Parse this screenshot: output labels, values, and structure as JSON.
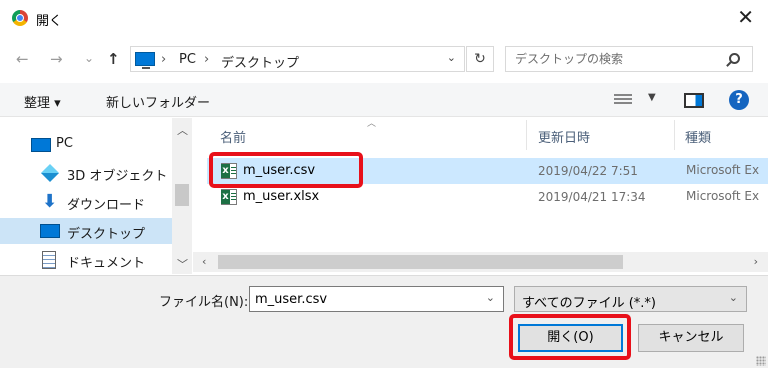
{
  "window": {
    "title": "開く",
    "close_glyph": "✕"
  },
  "nav": {
    "back_glyph": "←",
    "forward_glyph": "→",
    "recent_glyph": "⌄",
    "up_glyph": "↑",
    "breadcrumb": [
      "PC",
      "デスクトップ"
    ],
    "crumb_separator": "›",
    "refresh_glyph": "↻",
    "search_placeholder": "デスクトップの検索"
  },
  "toolbar": {
    "organize_label": "整理 ▾",
    "new_folder_label": "新しいフォルダー",
    "help_glyph": "?"
  },
  "sidebar": {
    "items": [
      {
        "label": "PC",
        "icon": "pc-icon",
        "selected": false
      },
      {
        "label": "3D オブジェクト",
        "icon": "3d-objects-icon",
        "selected": false
      },
      {
        "label": "ダウンロード",
        "icon": "download-icon",
        "selected": false
      },
      {
        "label": "デスクトップ",
        "icon": "desktop-icon",
        "selected": true
      },
      {
        "label": "ドキュメント",
        "icon": "documents-icon",
        "selected": false
      }
    ]
  },
  "file_list": {
    "columns": [
      "名前",
      "更新日時",
      "種類"
    ],
    "rows": [
      {
        "name": "m_user.csv",
        "modified": "2019/04/22 7:51",
        "type": "Microsoft Ex",
        "icon": "excel-csv-icon",
        "selected": true
      },
      {
        "name": "m_user.xlsx",
        "modified": "2019/04/21 17:34",
        "type": "Microsoft Ex",
        "icon": "excel-xlsx-icon",
        "selected": false
      }
    ]
  },
  "bottom": {
    "filename_label": "ファイル名(N):",
    "filename_value": "m_user.csv",
    "filetype_value": "すべてのファイル (*.*)",
    "open_label": "開く(O)",
    "cancel_label": "キャンセル"
  },
  "colors": {
    "accent": "#0078d7",
    "selection": "#cce8ff",
    "highlight_annotation": "#e8101a"
  }
}
